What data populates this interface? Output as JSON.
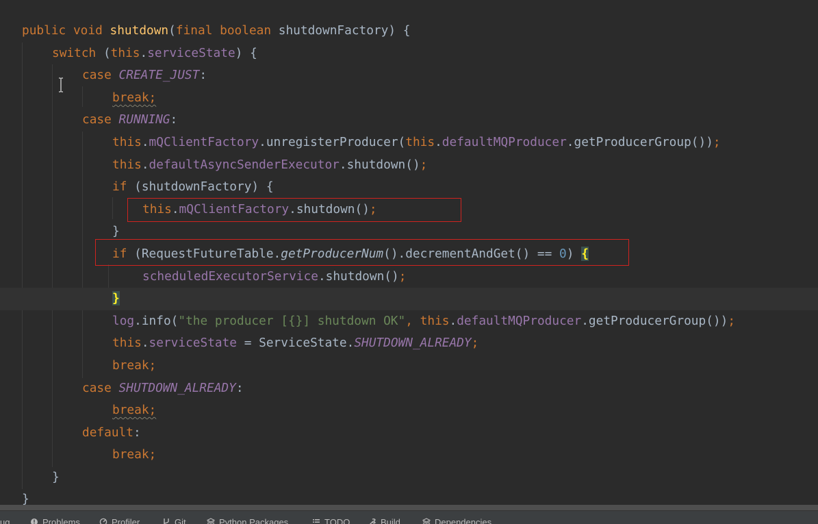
{
  "colors": {
    "background": "#2b2b2b",
    "keyword": "#cc7832",
    "method_decl": "#ffc66d",
    "field": "#9876aa",
    "string": "#6a8759",
    "number": "#6897bb",
    "text": "#a9b7c6",
    "highlight_box": "#d0231f"
  },
  "code": {
    "l1": {
      "t1": "public",
      "t2": " ",
      "t3": "void",
      "t4": " ",
      "t5": "shutdown",
      "t6": "(",
      "t7": "final",
      "t8": " ",
      "t9": "boolean",
      "t10": " shutdownFactory) {"
    },
    "l2": {
      "t1": "switch",
      "t2": " (",
      "t3": "this",
      "t4": ".",
      "t5": "serviceState",
      "t6": ") {"
    },
    "l3": {
      "t1": "case",
      "t2": " ",
      "t3": "CREATE_JUST",
      "t4": ":"
    },
    "l4": {
      "t1": "break;"
    },
    "l5": {
      "t1": "case",
      "t2": " ",
      "t3": "RUNNING",
      "t4": ":"
    },
    "l6": {
      "t1": "this",
      "t2": ".",
      "t3": "mQClientFactory",
      "t4": ".unregisterProducer(",
      "t5": "this",
      "t6": ".",
      "t7": "defaultMQProducer",
      "t8": ".getProducerGroup())",
      "t9": ";"
    },
    "l7": {
      "t1": "this",
      "t2": ".",
      "t3": "defaultAsyncSenderExecutor",
      "t4": ".shutdown()",
      "t5": ";"
    },
    "l8": {
      "t1": "if",
      "t2": " (shutdownFactory) {"
    },
    "l9": {
      "t1": "this",
      "t2": ".",
      "t3": "mQClientFactory",
      "t4": ".shutdown()",
      "t5": ";"
    },
    "l10": {
      "t1": "}"
    },
    "l11": {
      "t1": "if",
      "t2": " (RequestFutureTable.",
      "t3": "getProducerNum",
      "t4": "().decrementAndGet() == ",
      "t5": "0",
      "t6": ") ",
      "t7": "{"
    },
    "l12": {
      "t1": "scheduledExecutorService",
      "t2": ".shutdown()",
      "t3": ";"
    },
    "l13": {
      "t1": "}"
    },
    "l14": {
      "t1": "log",
      "t2": ".info(",
      "t3": "\"the producer [{}] shutdown OK\"",
      "t4": ", ",
      "t5": "this",
      "t6": ".",
      "t7": "defaultMQProducer",
      "t8": ".getProducerGroup())",
      "t9": ";"
    },
    "l15": {
      "t1": "this",
      "t2": ".",
      "t3": "serviceState",
      "t4": " = ServiceState.",
      "t5": "SHUTDOWN_ALREADY",
      "t6": ";"
    },
    "l16": {
      "t1": "break;"
    },
    "l17": {
      "t1": "case",
      "t2": " ",
      "t3": "SHUTDOWN_ALREADY",
      "t4": ":"
    },
    "l18": {
      "t1": "break;"
    },
    "l19": {
      "t1": "default",
      "t2": ":"
    },
    "l20": {
      "t1": "break;"
    },
    "l21": {
      "t1": "}"
    },
    "l22": {
      "t1": "}"
    }
  },
  "toolbar": {
    "items": [
      {
        "label": "ug",
        "icon": "debug-icon"
      },
      {
        "label": "Problems",
        "icon": "problems-icon"
      },
      {
        "label": "Profiler",
        "icon": "profiler-icon"
      },
      {
        "label": "Git",
        "icon": "git-icon"
      },
      {
        "label": "Python Packages",
        "icon": "python-packages-icon"
      },
      {
        "label": "TODO",
        "icon": "todo-icon"
      },
      {
        "label": "Build",
        "icon": "build-icon"
      },
      {
        "label": "Dependencies",
        "icon": "dependencies-icon"
      }
    ]
  }
}
